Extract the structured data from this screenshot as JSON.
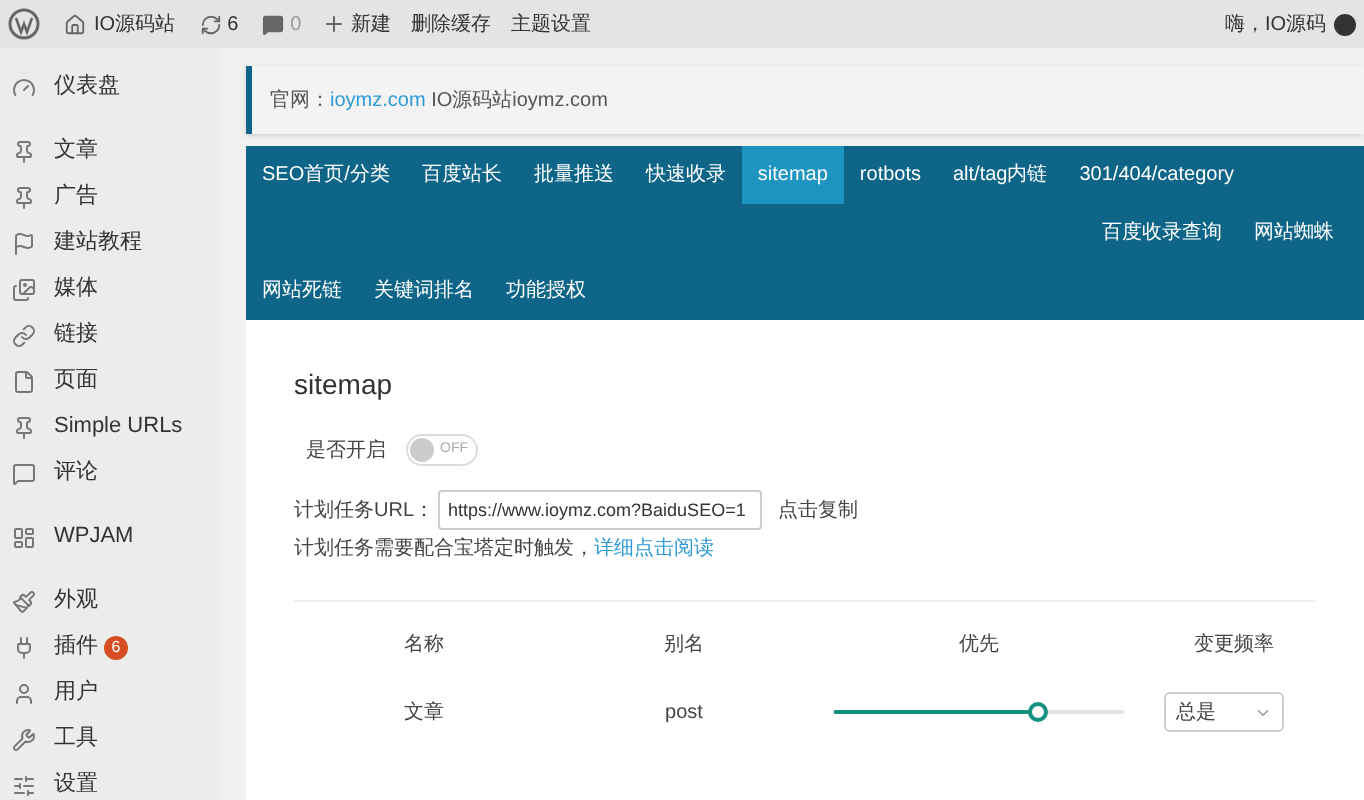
{
  "admin_bar": {
    "site": "IO源码站",
    "updates": "6",
    "comments": "0",
    "new": "新建",
    "links": [
      "删除缓存",
      "主题设置"
    ],
    "greeting": "嗨，IO源码"
  },
  "sidebar": {
    "groups": [
      [
        {
          "label": "仪表盘"
        }
      ],
      [
        {
          "label": "文章"
        },
        {
          "label": "广告"
        },
        {
          "label": "建站教程"
        },
        {
          "label": "媒体"
        },
        {
          "label": "链接"
        },
        {
          "label": "页面"
        },
        {
          "label": "Simple URLs"
        },
        {
          "label": "评论"
        }
      ],
      [
        {
          "label": "WPJAM"
        }
      ],
      [
        {
          "label": "外观"
        },
        {
          "label": "插件",
          "badge": "6"
        },
        {
          "label": "用户"
        },
        {
          "label": "工具"
        },
        {
          "label": "设置"
        }
      ]
    ]
  },
  "notice": {
    "prefix": "官网：",
    "link": "ioymz.com",
    "suffix": "IO源码站ioymz.com"
  },
  "tab_rows": [
    [
      {
        "label": "SEO首页/分类",
        "selected": false
      },
      {
        "label": "百度站长",
        "selected": false
      },
      {
        "label": "批量推送",
        "selected": false
      },
      {
        "label": "快速收录",
        "selected": false
      },
      {
        "label": "sitemap",
        "selected": true
      },
      {
        "label": "rotbots",
        "selected": false
      },
      {
        "label": "alt/tag内链",
        "selected": false
      },
      {
        "label": "301/404/category",
        "selected": false
      }
    ],
    [
      {
        "label": "百度收录查询",
        "selected": false
      },
      {
        "label": "网站蜘蛛",
        "selected": false
      }
    ],
    [
      {
        "label": "网站死链",
        "selected": false
      },
      {
        "label": "关键词排名",
        "selected": false
      },
      {
        "label": "功能授权",
        "selected": false
      }
    ]
  ],
  "panel": {
    "title": "sitemap",
    "enable_label": "是否开启",
    "enable": {
      "on": false,
      "text": "OFF"
    },
    "url_label": "计划任务URL：",
    "url_value": "https://www.ioymz.com?BaiduSEO=1",
    "copy": "点击复制",
    "hint": "计划任务需要配合宝塔定时触发，",
    "hint_link": "详细点击阅读"
  },
  "table": {
    "columns": [
      "名称",
      "别名",
      "优先",
      "变更频率"
    ],
    "rows": [
      {
        "name": "文章",
        "alias": "post",
        "level": 0.7,
        "frequency": "总是"
      }
    ]
  }
}
